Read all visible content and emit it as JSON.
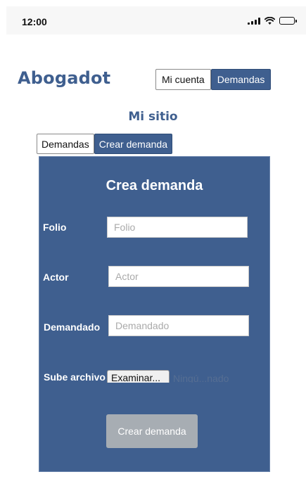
{
  "status_bar": {
    "time": "12:00",
    "icons": [
      "signal-icon",
      "wifi-icon",
      "battery-icon"
    ]
  },
  "brand": {
    "name": "Abogadot"
  },
  "top_nav": {
    "items": [
      {
        "label": "Mi cuenta",
        "active": false
      },
      {
        "label": "Demandas",
        "active": true
      }
    ]
  },
  "section": {
    "title": "Mi sitio"
  },
  "sub_nav": {
    "items": [
      {
        "label": "Demandas",
        "active": false
      },
      {
        "label": "Crear demanda",
        "active": true
      }
    ]
  },
  "form": {
    "title": "Crea demanda",
    "fields": [
      {
        "label": "Folio",
        "placeholder": "Folio",
        "value": ""
      },
      {
        "label": "Actor",
        "placeholder": "Actor",
        "value": ""
      },
      {
        "label": "Demandado",
        "placeholder": "Demandado",
        "value": ""
      }
    ],
    "file": {
      "label": "Sube archivo",
      "button_label": "Examinar...",
      "status_text": "Ningú...nado"
    },
    "submit_label": "Crear demanda"
  },
  "colors": {
    "primary": "#3f5f8f",
    "submit_disabled": "#a7adb3",
    "background": "#ffffff"
  }
}
